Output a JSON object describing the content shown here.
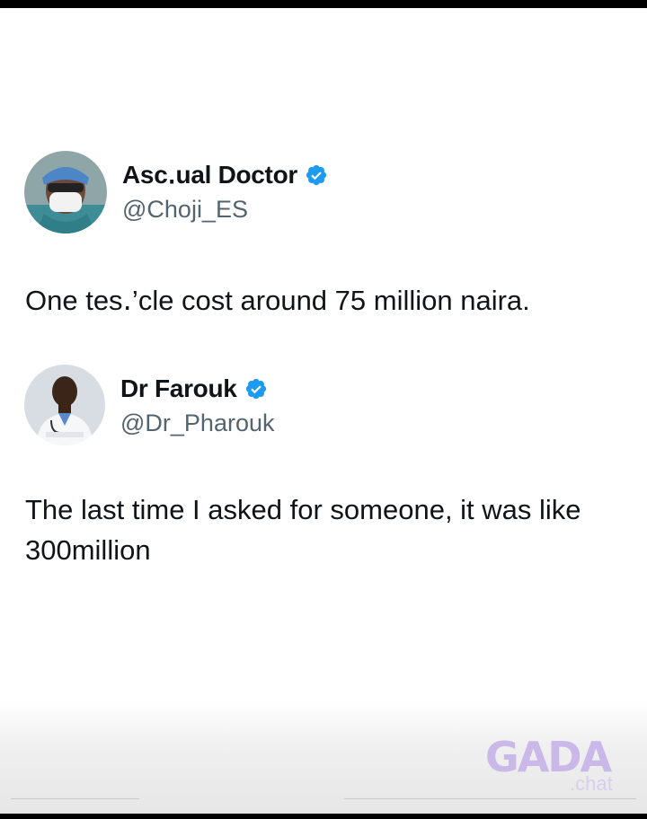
{
  "tweets": [
    {
      "display_name": "Asc․ual Doctor",
      "handle": "@Choji_ES",
      "text": "One tes․’cle cost around 75 million naira.",
      "verified": true,
      "avatar_icon": "avatar-masked-doctor"
    },
    {
      "display_name": "Dr Farouk",
      "handle": "@Dr_Pharouk",
      "text": "The last time I asked for someone, it was like 300million",
      "verified": true,
      "avatar_icon": "avatar-doctor-labcoat"
    }
  ],
  "watermark": {
    "logo": "GADA",
    "sub": ".chat"
  },
  "colors": {
    "verified": "#1d9bf0",
    "handle": "#536471",
    "watermark": "#c9b8e8"
  }
}
